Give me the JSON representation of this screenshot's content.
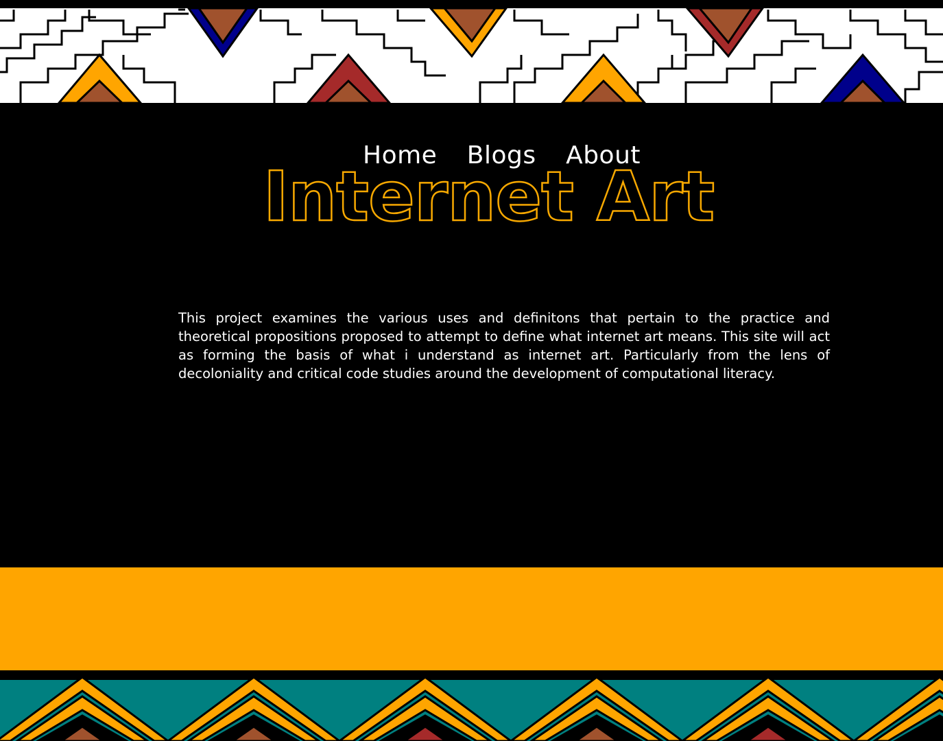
{
  "nav": {
    "items": [
      {
        "label": "Home"
      },
      {
        "label": "Blogs"
      },
      {
        "label": "About"
      }
    ]
  },
  "header": {
    "title": "Internet Art"
  },
  "main": {
    "intro": "This project examines the various uses and definitons that pertain to the practice and theoretical propositions proposed to attempt to define what internet art means. This site will act as forming the basis of what i understand as internet art. Particularly from the lens of decoloniality and critical code studies around the development of computational literacy."
  },
  "colors": {
    "background": "#000000",
    "accent_orange": "#ffa500",
    "title_stroke": "#f7a800",
    "teal": "#008080",
    "red": "#a52a2a",
    "brown": "#a0522d",
    "blue": "#00008b"
  }
}
